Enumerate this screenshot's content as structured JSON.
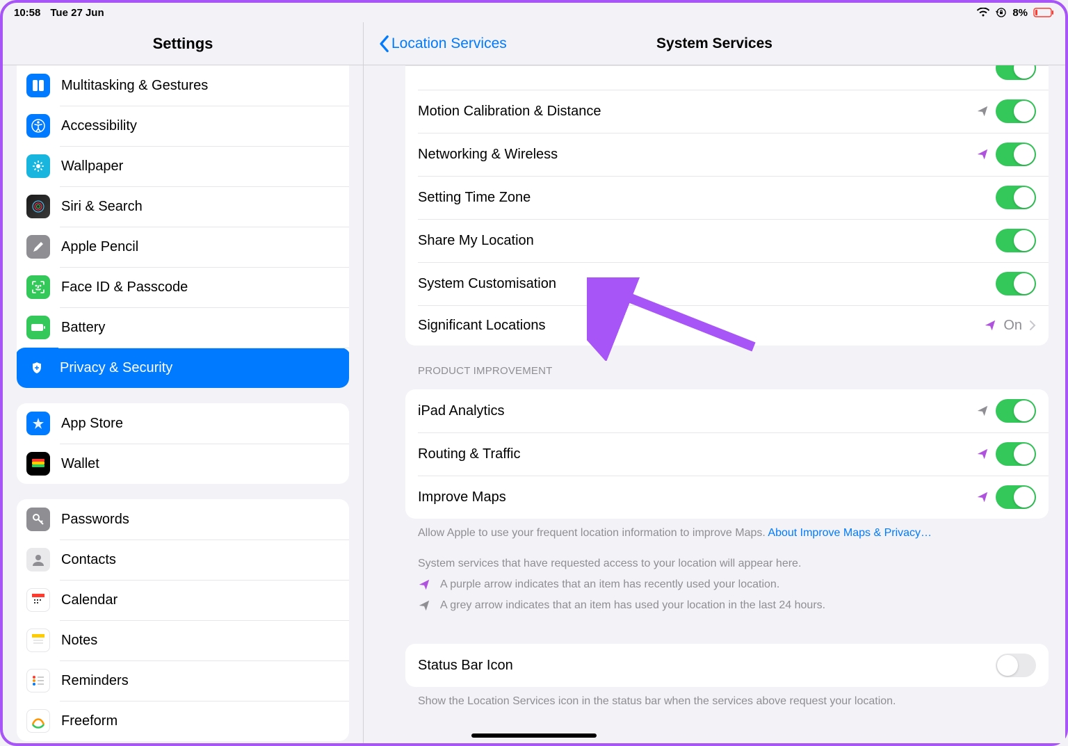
{
  "status": {
    "time": "10:58",
    "date": "Tue 27 Jun",
    "battery": "8%"
  },
  "sidebar": {
    "title": "Settings",
    "g1": [
      {
        "label": "Multitasking & Gestures"
      },
      {
        "label": "Accessibility"
      },
      {
        "label": "Wallpaper"
      },
      {
        "label": "Siri & Search"
      },
      {
        "label": "Apple Pencil"
      },
      {
        "label": "Face ID & Passcode"
      },
      {
        "label": "Battery"
      },
      {
        "label": "Privacy & Security"
      }
    ],
    "g2": [
      {
        "label": "App Store"
      },
      {
        "label": "Wallet"
      }
    ],
    "g3": [
      {
        "label": "Passwords"
      },
      {
        "label": "Contacts"
      },
      {
        "label": "Calendar"
      },
      {
        "label": "Notes"
      },
      {
        "label": "Reminders"
      },
      {
        "label": "Freeform"
      }
    ]
  },
  "detail": {
    "back": "Location Services",
    "title": "System Services",
    "s1": [
      {
        "label": "Motion Calibration & Distance",
        "arrow": "grey",
        "toggle": true
      },
      {
        "label": "Networking & Wireless",
        "arrow": "purple",
        "toggle": true
      },
      {
        "label": "Setting Time Zone",
        "arrow": null,
        "toggle": true
      },
      {
        "label": "Share My Location",
        "arrow": null,
        "toggle": true
      },
      {
        "label": "System Customisation",
        "arrow": null,
        "toggle": true
      },
      {
        "label": "Significant Locations",
        "arrow": "purple",
        "value": "On"
      }
    ],
    "s2_header": "PRODUCT IMPROVEMENT",
    "s2": [
      {
        "label": "iPad Analytics",
        "arrow": "grey",
        "toggle": true
      },
      {
        "label": "Routing & Traffic",
        "arrow": "purple",
        "toggle": true
      },
      {
        "label": "Improve Maps",
        "arrow": "purple",
        "toggle": true
      }
    ],
    "s2_footer": "Allow Apple to use your frequent location information to improve Maps.",
    "s2_link": "About Improve Maps & Privacy…",
    "legend_intro": "System services that have requested access to your location will appear here.",
    "legend_purple": "A purple arrow indicates that an item has recently used your location.",
    "legend_grey": "A grey arrow indicates that an item has used your location in the last 24 hours.",
    "s3": {
      "label": "Status Bar Icon",
      "toggle": false
    },
    "s3_footer": "Show the Location Services icon in the status bar when the services above request your location."
  }
}
